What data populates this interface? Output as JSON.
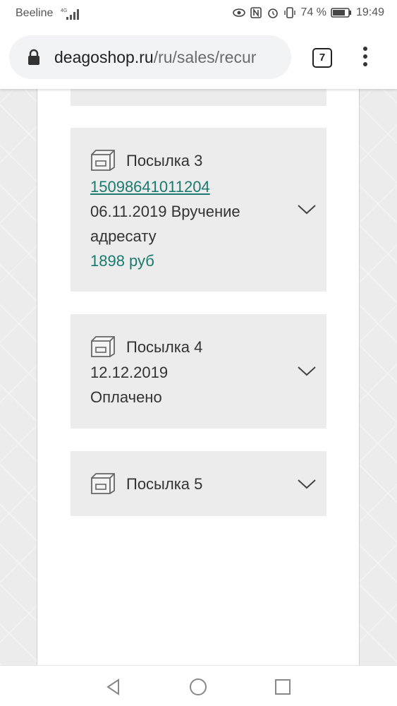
{
  "status_bar": {
    "carrier": "Beeline",
    "network": "4G",
    "battery": "74 %",
    "time": "19:49"
  },
  "browser": {
    "url_domain": "deagoshop.ru",
    "url_path": "/ru/sales/recur",
    "tab_count": "7"
  },
  "parcels": [
    {
      "title": "Посылка 3",
      "tracking": "15098641011204",
      "status_line1": "06.11.2019 Вручение",
      "status_line2": "адресату",
      "price": "1898 руб"
    },
    {
      "title": "Посылка 4",
      "status_line1": "12.12.2019",
      "status_line2": "Оплачено"
    },
    {
      "title": "Посылка 5"
    }
  ],
  "colors": {
    "accent": "#1a7a6e",
    "card_bg": "#ececec",
    "text": "#333333"
  }
}
